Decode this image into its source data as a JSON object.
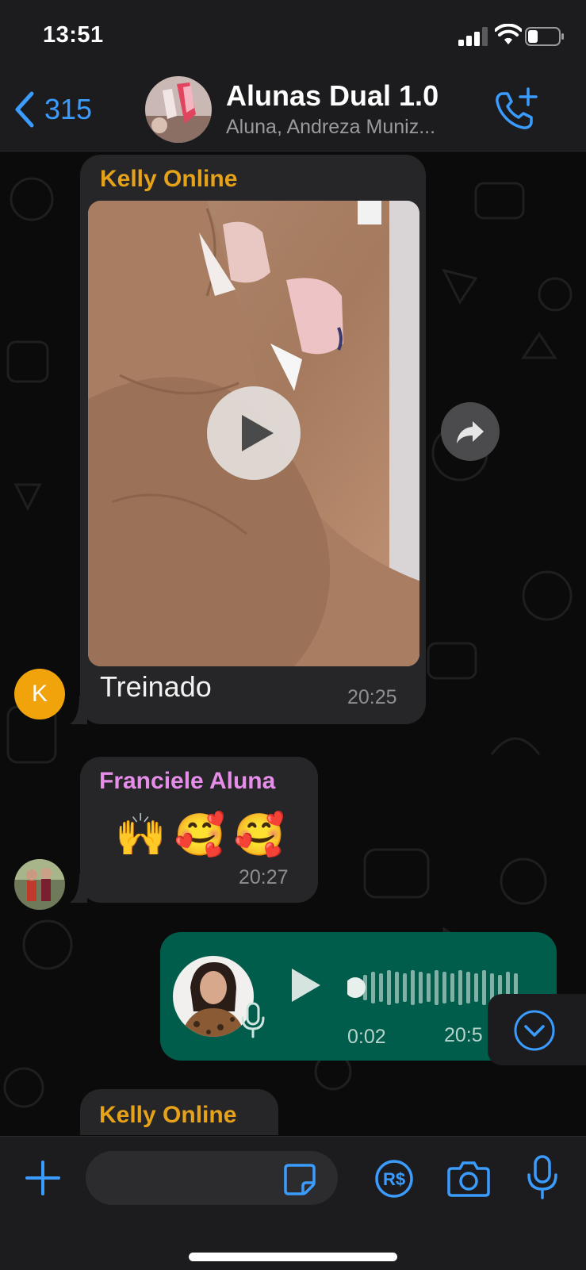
{
  "status_bar": {
    "time": "13:51"
  },
  "header": {
    "back_count": "315",
    "group_name": "Alunas Dual 1.0",
    "members": "Aluna, Andreza Muniz..."
  },
  "messages": [
    {
      "type": "video",
      "sender": "Kelly Online",
      "sender_color": "#e6a31a",
      "caption": "Treinado",
      "time": "20:25",
      "avatar_letter": "K",
      "avatar_color": "#f0a30a"
    },
    {
      "type": "emoji",
      "sender": "Franciele Aluna",
      "sender_color": "#e68de9",
      "text": "🙌🥰🥰",
      "time": "20:27"
    },
    {
      "type": "voice",
      "outgoing": true,
      "duration": "0:02",
      "time": "20:5"
    },
    {
      "type": "text",
      "sender": "Kelly Online",
      "sender_color": "#e6a31a"
    }
  ],
  "icons": {
    "back": "chevron-left-icon",
    "call": "phone-plus-icon",
    "play": "play-icon",
    "forward": "forward-icon",
    "scroll_down": "chevron-down-circle-icon",
    "attach": "plus-icon",
    "sticker": "sticker-icon",
    "payment": "real-currency-icon",
    "camera": "camera-icon",
    "mic": "microphone-icon"
  },
  "colors": {
    "accent": "#3b9cff",
    "outgoing_bubble": "#005c4b",
    "incoming_bubble": "#262628"
  }
}
